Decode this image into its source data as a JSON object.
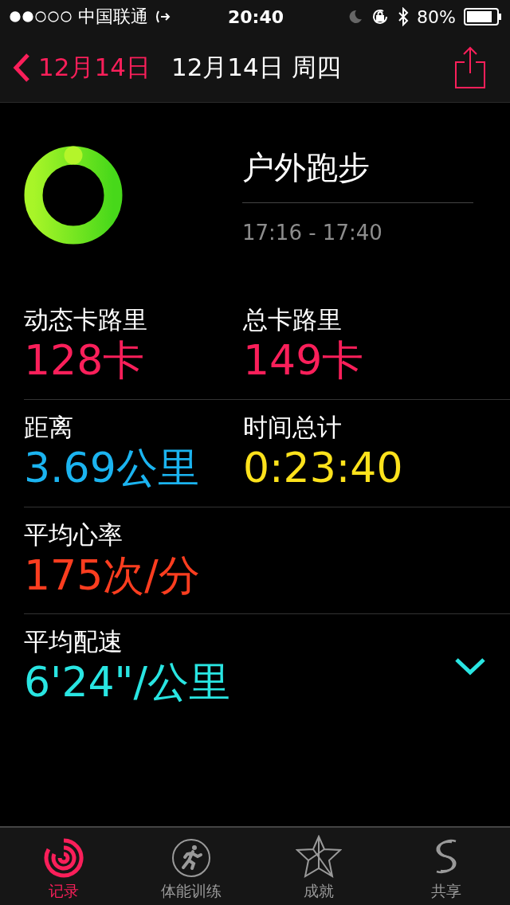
{
  "status_bar": {
    "carrier": "中国联通",
    "time": "20:40",
    "battery": "80%"
  },
  "nav": {
    "back": "12月14日",
    "title": "12月14日 周四"
  },
  "workout": {
    "name": "户外跑步",
    "time_range": "17:16 - 17:40"
  },
  "metric_rows": [
    {
      "cells": [
        {
          "label": "动态卡路里",
          "value": "128卡",
          "color": "#fa1f5a"
        },
        {
          "label": "总卡路里",
          "value": "149卡",
          "color": "#fa1f5a"
        }
      ]
    },
    {
      "cells": [
        {
          "label": "距离",
          "value": "3.69公里",
          "color": "#1bb4f0"
        },
        {
          "label": "时间总计",
          "value": "0:23:40",
          "color": "#fde21c"
        }
      ]
    },
    {
      "cells": [
        {
          "label": "平均心率",
          "value": "175次/分",
          "color": "#fc3d1f"
        }
      ]
    },
    {
      "cells": [
        {
          "label": "平均配速",
          "value": "6'24\"/公里",
          "color": "#29e5e2"
        }
      ],
      "more": true
    }
  ],
  "tabs": [
    {
      "label": "记录",
      "kind": "rings",
      "selected": true
    },
    {
      "label": "体能训练",
      "kind": "runner",
      "selected": false
    },
    {
      "label": "成就",
      "kind": "star",
      "selected": false
    },
    {
      "label": "共享",
      "kind": "share",
      "selected": false
    }
  ]
}
